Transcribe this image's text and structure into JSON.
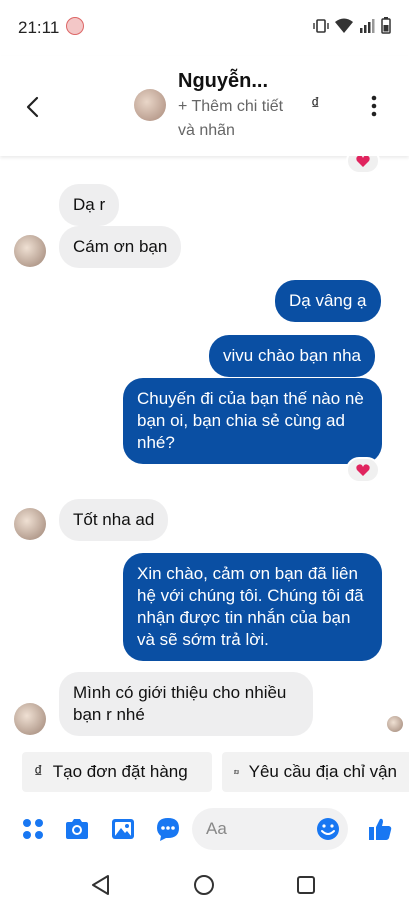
{
  "status": {
    "time": "21:11"
  },
  "header": {
    "name": "Nguyễn...",
    "subtitle": "+ Thêm chi tiết và nhãn",
    "currency_symbol": "₫"
  },
  "messages": [
    {
      "side": "in",
      "text": "Dạ r"
    },
    {
      "side": "in",
      "text": "Cám ơn bạn"
    },
    {
      "side": "out",
      "text": "Dạ vâng ạ"
    },
    {
      "side": "out",
      "text": "vivu chào bạn nha"
    },
    {
      "side": "out",
      "text": "Chuyến đi của bạn thế nào nè bạn oi, bạn chia sẻ cùng ad nhé?"
    },
    {
      "side": "in",
      "text": "Tốt nha ad"
    },
    {
      "side": "out",
      "text": "Xin chào, cảm ơn bạn đã liên hệ với chúng tôi. Chúng tôi đã nhận được tin nhắn của bạn và sẽ sớm trả lời."
    },
    {
      "side": "in",
      "text": "Mình có giới thiệu cho nhiều bạn r nhé"
    }
  ],
  "quick_replies": {
    "create_order": {
      "icon": "₫",
      "label": "Tạo đơn đặt hàng"
    },
    "request_address": {
      "label": "Yêu cầu địa chỉ vận"
    }
  },
  "composer": {
    "placeholder": "Aa"
  },
  "colors": {
    "accent": "#0a4fa3",
    "icon_blue": "#1877f2",
    "incoming": "#eeeeef"
  }
}
